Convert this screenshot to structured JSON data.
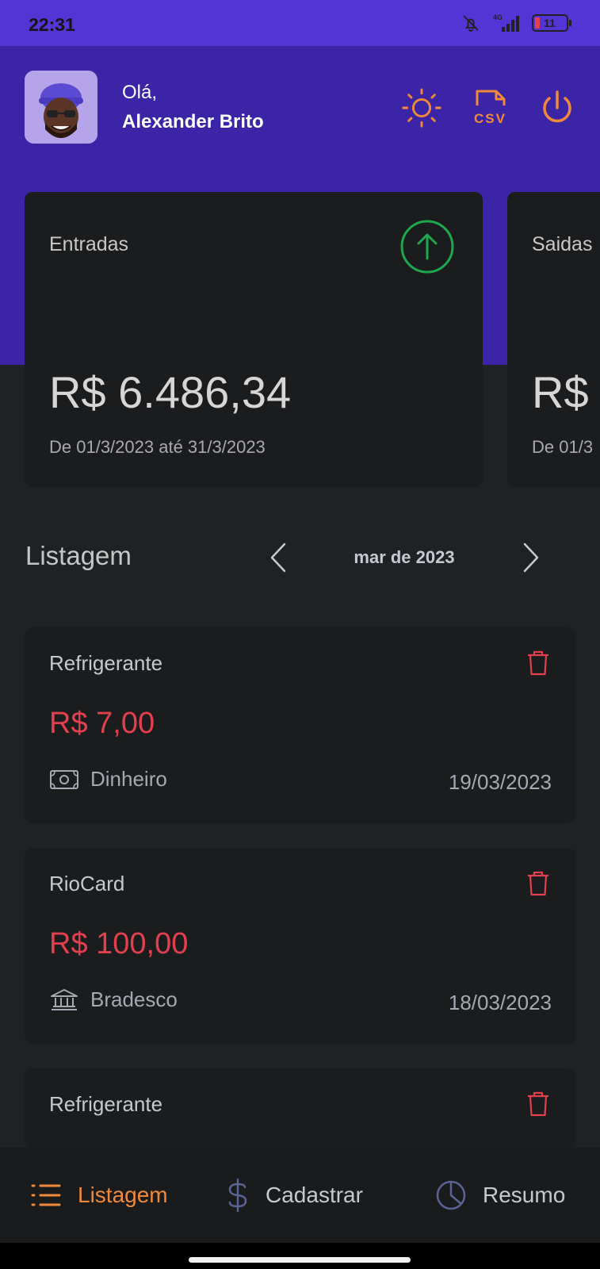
{
  "status_bar": {
    "time": "22:31",
    "network": "4G",
    "battery": "11"
  },
  "header": {
    "greeting": "Olá,",
    "user_name": "Alexander Brito",
    "csv_label": "CSV"
  },
  "cards": [
    {
      "title": "Entradas",
      "amount": "R$ 6.486,34",
      "range": "De 01/3/2023 até 31/3/2023",
      "icon": "arrow-up-circle-icon",
      "icon_color": "#1ea74d"
    },
    {
      "title": "Saidas",
      "amount": "R$",
      "range": "De 01/3"
    }
  ],
  "listing": {
    "title": "Listagem",
    "month": "mar de 2023"
  },
  "transactions": [
    {
      "name": "Refrigerante",
      "amount": "R$ 7,00",
      "method": "Dinheiro",
      "method_icon": "cash-icon",
      "date": "19/03/2023"
    },
    {
      "name": "RioCard",
      "amount": "R$ 100,00",
      "method": "Bradesco",
      "method_icon": "bank-icon",
      "date": "18/03/2023"
    },
    {
      "name": "Refrigerante"
    }
  ],
  "bottom_nav": {
    "items": [
      {
        "label": "Listagem",
        "icon": "list-icon",
        "active": true
      },
      {
        "label": "Cadastrar",
        "icon": "dollar-icon",
        "active": false
      },
      {
        "label": "Resumo",
        "icon": "pie-chart-icon",
        "active": false
      }
    ]
  },
  "colors": {
    "header_bg": "#3c24a6",
    "status_bg": "#5335d6",
    "accent_orange": "#f08a3a",
    "income_green": "#1ea74d",
    "expense_red": "#e2404f",
    "inactive_nav": "#5a6394"
  }
}
